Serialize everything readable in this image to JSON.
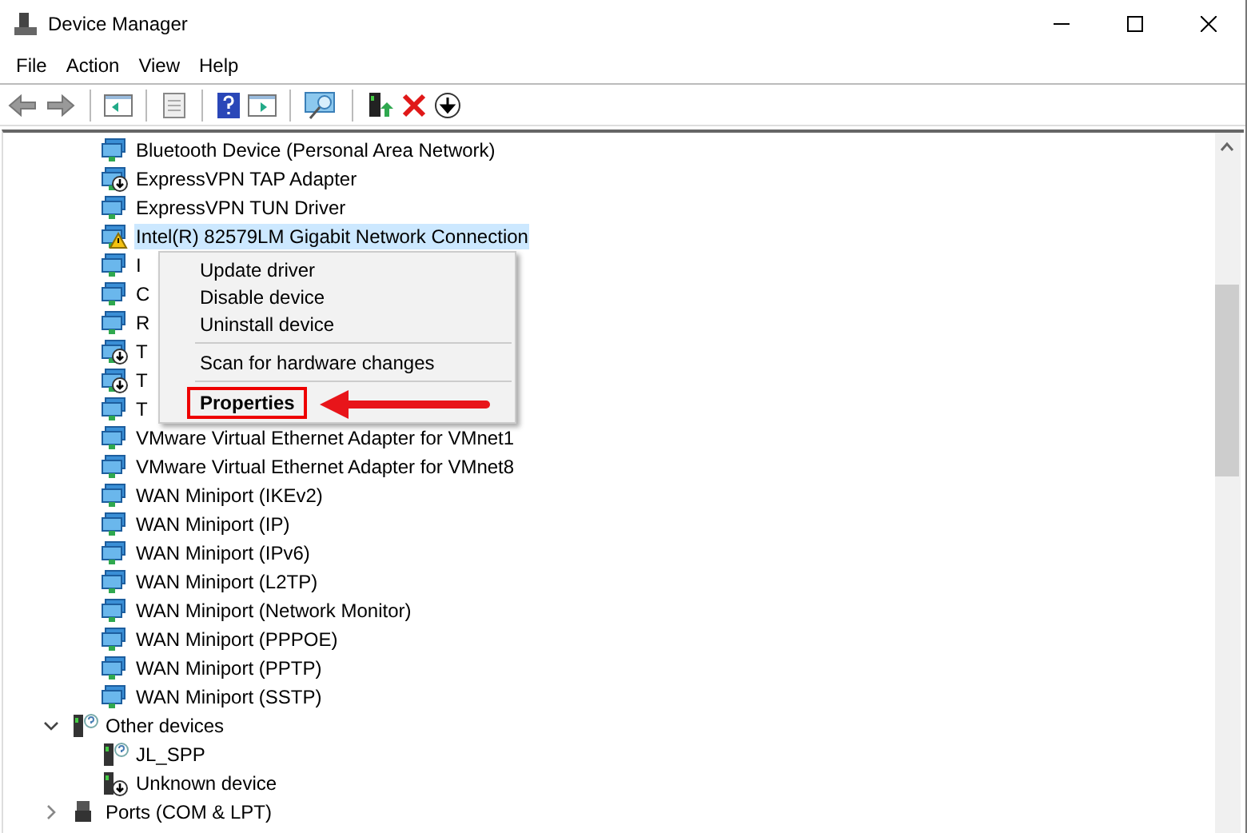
{
  "window": {
    "title": "Device Manager"
  },
  "menu": [
    "File",
    "Action",
    "View",
    "Help"
  ],
  "tree": [
    {
      "children": [
        {
          "label": "Bluetooth Device (Personal Area Network)",
          "kind": "adapter",
          "selected": false
        },
        {
          "label": "ExpressVPN TAP Adapter",
          "kind": "disabled",
          "selected": false
        },
        {
          "label": "ExpressVPN TUN Driver",
          "kind": "adapter",
          "selected": false
        },
        {
          "label": "Intel(R) 82579LM Gigabit Network Connection",
          "kind": "warning",
          "selected": true
        },
        {
          "label": "I",
          "kind": "adapter",
          "selected": false
        },
        {
          "label": "C",
          "kind": "adapter",
          "selected": false
        },
        {
          "label": "R",
          "kind": "adapter",
          "selected": false
        },
        {
          "label": "T",
          "kind": "disabled",
          "selected": false
        },
        {
          "label": "T",
          "kind": "disabled",
          "selected": false
        },
        {
          "label": "T",
          "kind": "adapter",
          "selected": false
        },
        {
          "label": "VMware Virtual Ethernet Adapter for VMnet1",
          "kind": "adapter",
          "selected": false
        },
        {
          "label": "VMware Virtual Ethernet Adapter for VMnet8",
          "kind": "adapter",
          "selected": false
        },
        {
          "label": "WAN Miniport (IKEv2)",
          "kind": "adapter",
          "selected": false
        },
        {
          "label": "WAN Miniport (IP)",
          "kind": "adapter",
          "selected": false
        },
        {
          "label": "WAN Miniport (IPv6)",
          "kind": "adapter",
          "selected": false
        },
        {
          "label": "WAN Miniport (L2TP)",
          "kind": "adapter",
          "selected": false
        },
        {
          "label": "WAN Miniport (Network Monitor)",
          "kind": "adapter",
          "selected": false
        },
        {
          "label": "WAN Miniport (PPPOE)",
          "kind": "adapter",
          "selected": false
        },
        {
          "label": "WAN Miniport (PPTP)",
          "kind": "adapter",
          "selected": false
        },
        {
          "label": "WAN Miniport (SSTP)",
          "kind": "adapter",
          "selected": false
        }
      ]
    },
    {
      "label": "Other devices",
      "kind": "unknown",
      "expanded": true,
      "selected": false,
      "children": [
        {
          "label": "JL_SPP",
          "kind": "unknown",
          "selected": false
        },
        {
          "label": "Unknown device",
          "kind": "stopped",
          "selected": false
        }
      ]
    },
    {
      "label": "Ports (COM & LPT)",
      "kind": "port",
      "expanded": false,
      "selected": false
    }
  ],
  "context_menu": {
    "items": [
      {
        "kind": "item",
        "label": "Update driver",
        "selected": false
      },
      {
        "kind": "item",
        "label": "Disable device",
        "selected": false
      },
      {
        "kind": "item",
        "label": "Uninstall device",
        "selected": false
      },
      {
        "kind": "separator"
      },
      {
        "kind": "item",
        "label": "Scan for hardware changes",
        "selected": false
      },
      {
        "kind": "separator"
      },
      {
        "kind": "item",
        "label": "Properties",
        "selected": true
      }
    ]
  }
}
